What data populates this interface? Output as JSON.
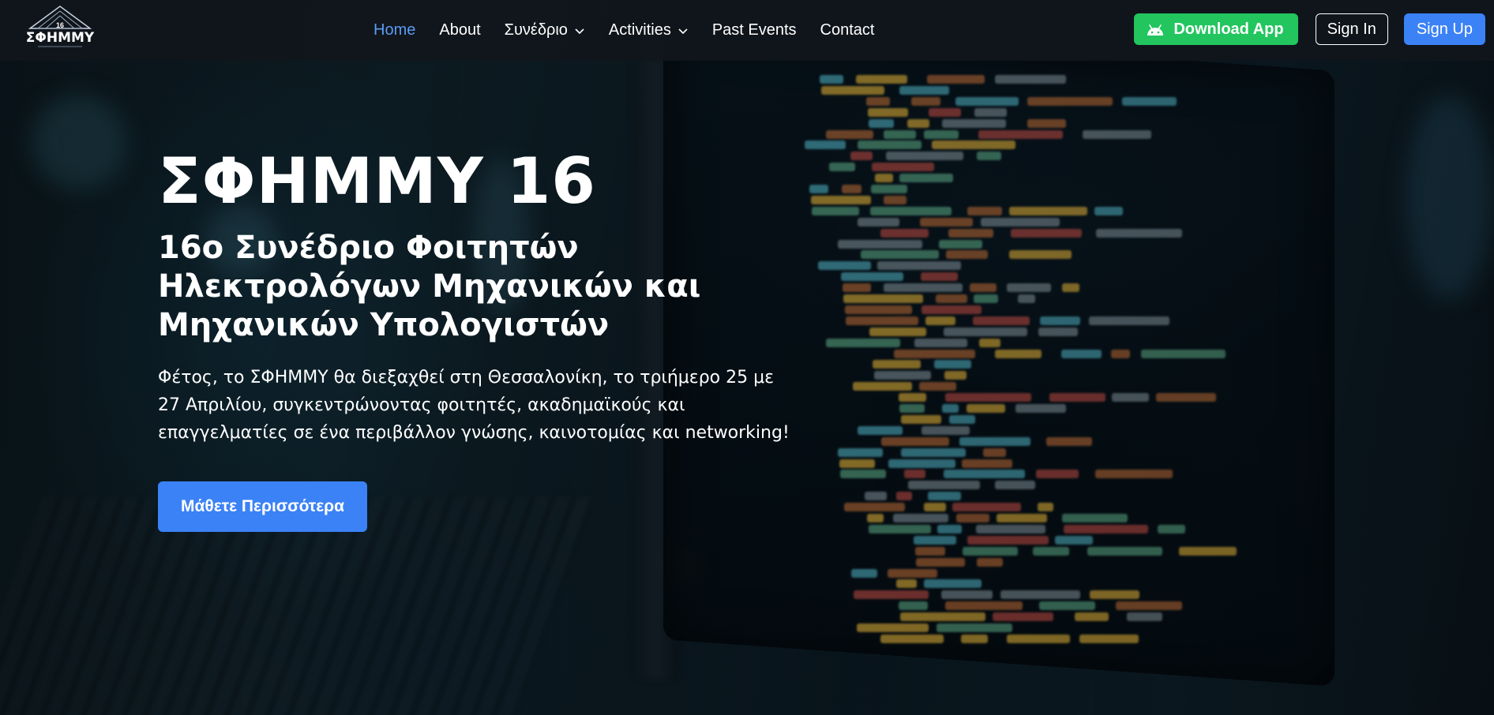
{
  "brand": {
    "logo_text": "ΣΦΗΜΜΥ",
    "logo_number": "16"
  },
  "nav": {
    "items": [
      {
        "label": "Home",
        "active": true,
        "dropdown": false
      },
      {
        "label": "About",
        "active": false,
        "dropdown": false
      },
      {
        "label": "Συνέδριο",
        "active": false,
        "dropdown": true
      },
      {
        "label": "Activities",
        "active": false,
        "dropdown": true
      },
      {
        "label": "Past Events",
        "active": false,
        "dropdown": false
      },
      {
        "label": "Contact",
        "active": false,
        "dropdown": false
      }
    ],
    "download_label": "Download App",
    "download_icon": "android-icon",
    "signin_label": "Sign In",
    "signup_label": "Sign Up"
  },
  "hero": {
    "title": "ΣΦΗΜΜΥ 16",
    "subtitle": "16ο Συνέδριο Φοιτητών Ηλεκτρολόγων Μηχανικών και Μηχανικών Υπολογιστών",
    "text": "Φέτος, το ΣΦΗΜΜΥ θα διεξαχθεί στη Θεσσαλονίκη, το τριήμερο 25 με 27 Απριλίου, συγκεντρώνοντας φοιτητές, ακαδημαϊκούς και επαγγελματίες σε ένα περιβάλλον γνώσης, καινοτομίας και networking!",
    "cta_label": "Μάθετε Περισσότερα"
  },
  "colors": {
    "accent": "#3b82f6",
    "active_link": "#5b9bf5",
    "download": "#22c55e",
    "navbar_bg": "#11161c"
  }
}
